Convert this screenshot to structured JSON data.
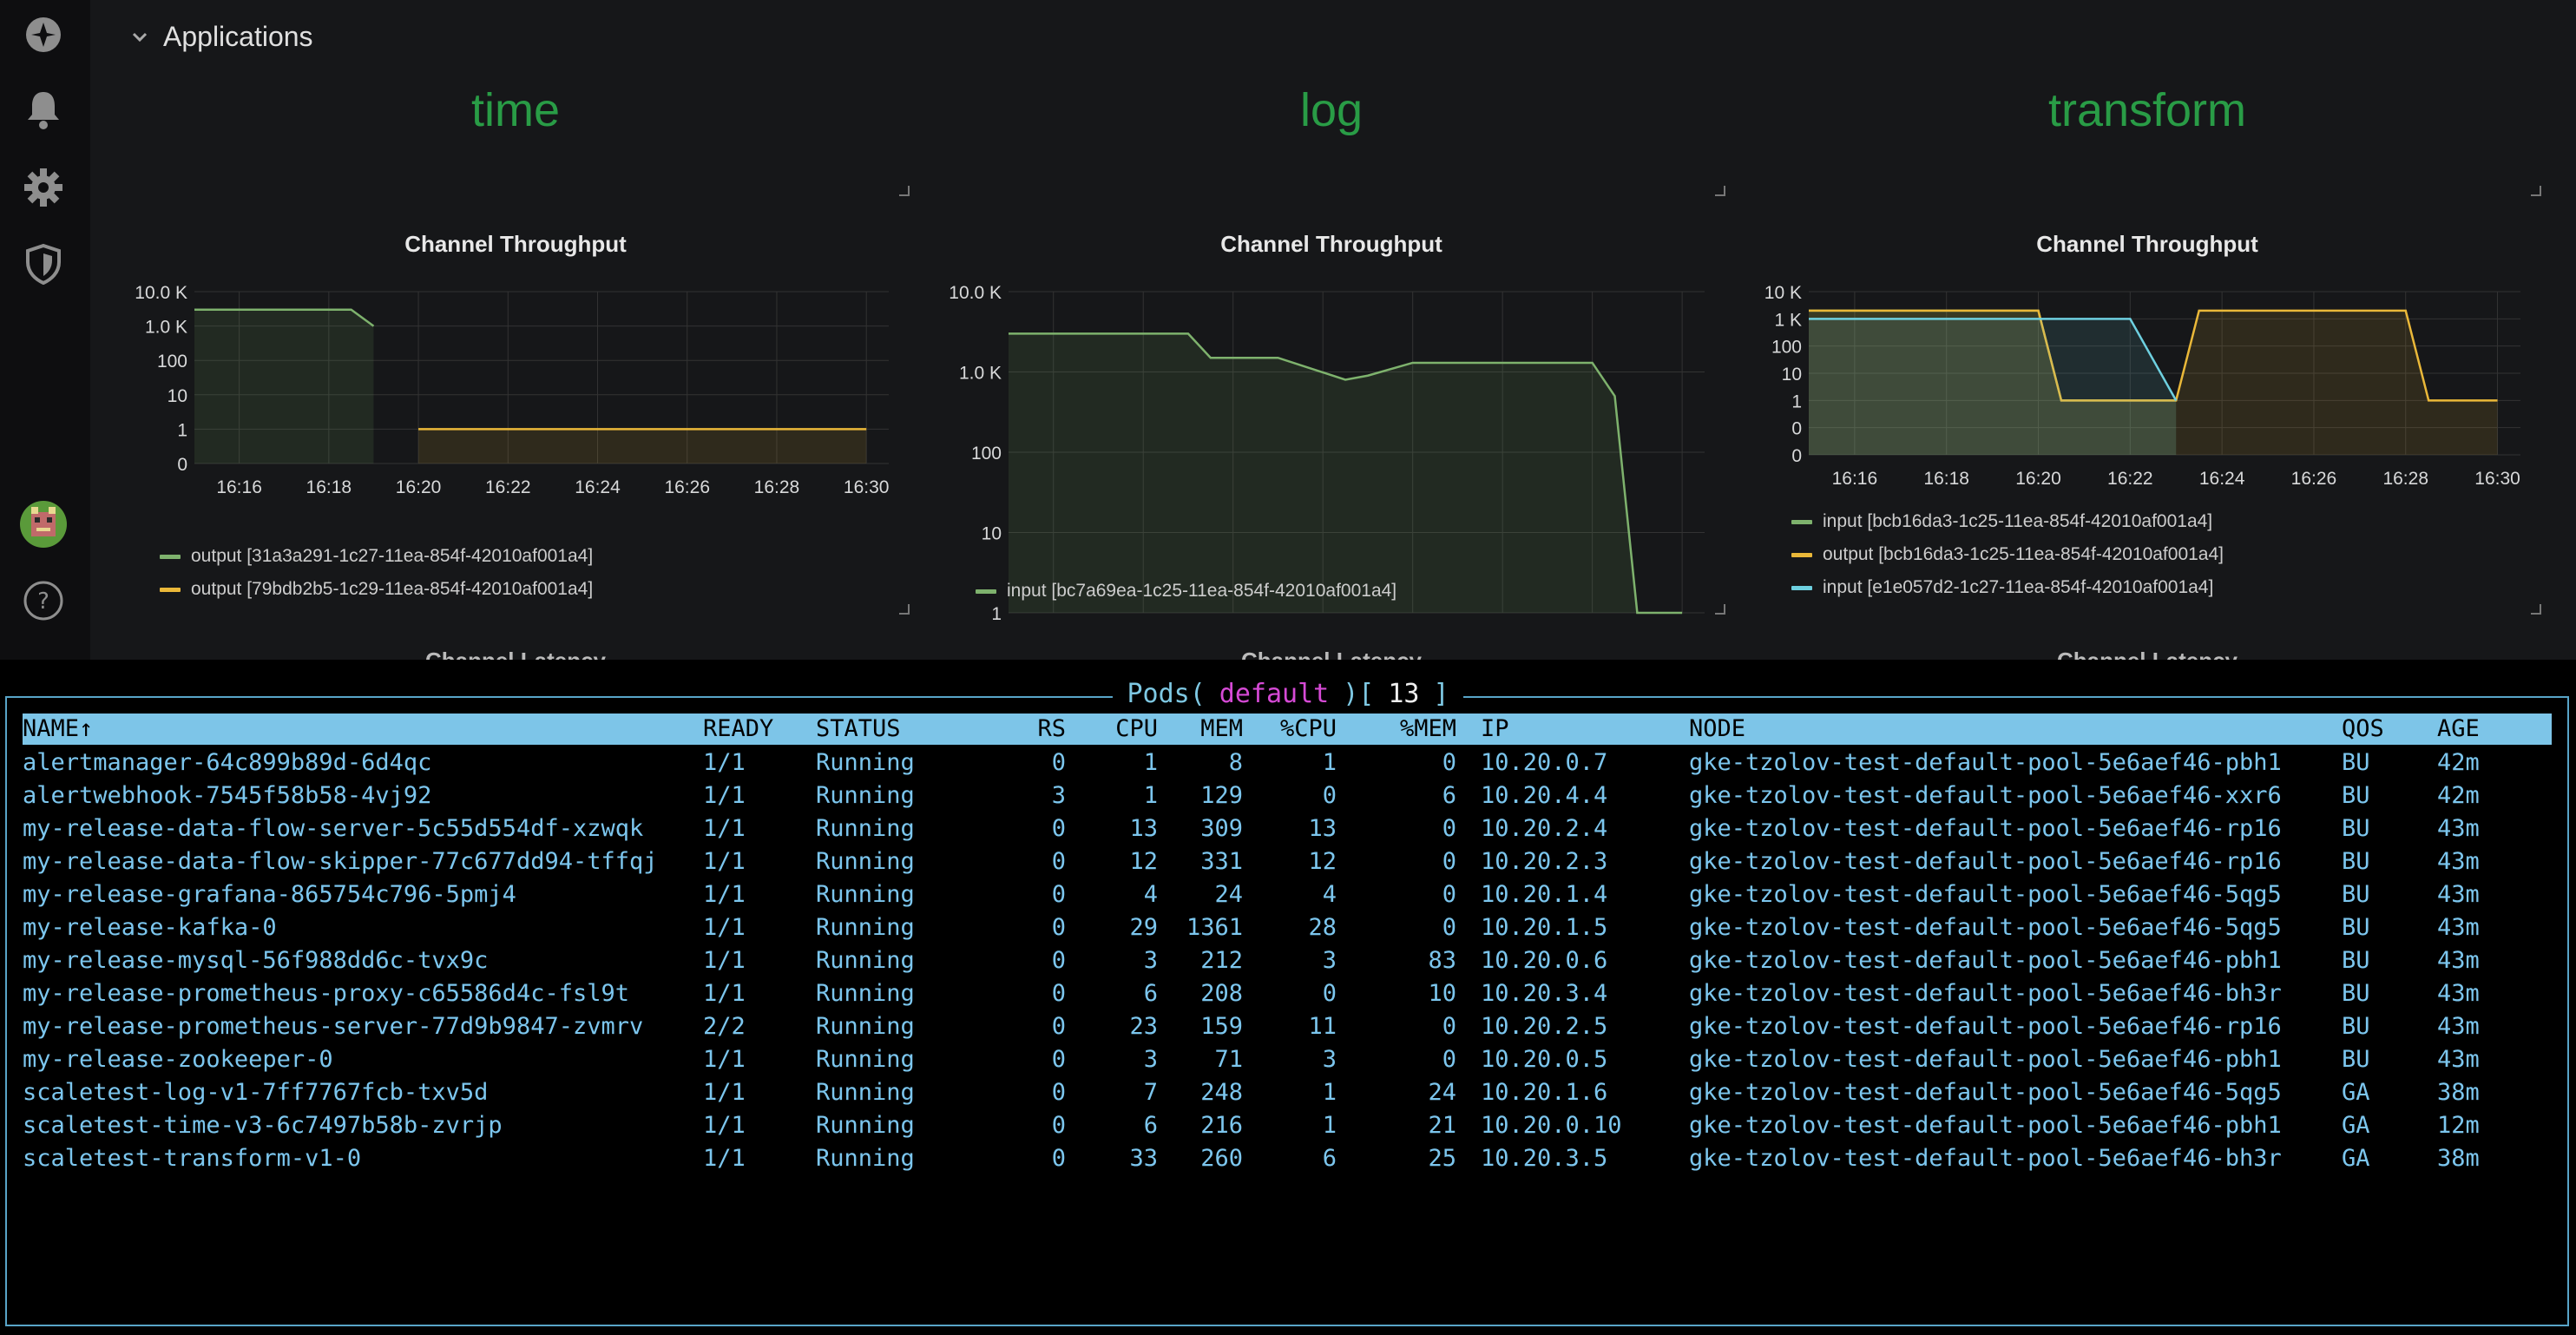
{
  "grafana": {
    "row_title": "Applications",
    "sidebar_icons": [
      "grafana-logo-icon",
      "bell-icon",
      "gear-icon",
      "shield-icon",
      "avatar",
      "help-icon"
    ],
    "panels": [
      {
        "app": "time",
        "chart_title": "Channel Throughput",
        "y_ticks": [
          "10.0 K",
          "1.0 K",
          "100",
          "10",
          "1",
          "0"
        ],
        "x_ticks": [
          "16:16",
          "16:18",
          "16:20",
          "16:22",
          "16:24",
          "16:26",
          "16:28",
          "16:30"
        ],
        "legend": [
          {
            "label": "output [31a3a291-1c27-11ea-854f-42010af001a4]",
            "color": "#7eb26d"
          },
          {
            "label": "output [79bdb2b5-1c29-11ea-854f-42010af001a4]",
            "color": "#eab839"
          }
        ],
        "next_title": "Channel Latency"
      },
      {
        "app": "log",
        "chart_title": "Channel Throughput",
        "y_ticks": [
          "10.0 K",
          "1.0 K",
          "100",
          "10",
          "1"
        ],
        "x_ticks": [
          "16:16",
          "16:18",
          "16:20",
          "16:22",
          "16:24",
          "16:26",
          "16:28",
          "16:30"
        ],
        "legend": [
          {
            "label": "input [bc7a69ea-1c25-11ea-854f-42010af001a4]",
            "color": "#7eb26d"
          }
        ],
        "next_title": "Channel Latency"
      },
      {
        "app": "transform",
        "chart_title": "Channel Throughput",
        "y_ticks": [
          "10 K",
          "1 K",
          "100",
          "10",
          "1",
          "0",
          "0"
        ],
        "x_ticks": [
          "16:16",
          "16:18",
          "16:20",
          "16:22",
          "16:24",
          "16:26",
          "16:28",
          "16:30"
        ],
        "legend": [
          {
            "label": "input [bcb16da3-1c25-11ea-854f-42010af001a4]",
            "color": "#7eb26d"
          },
          {
            "label": "output [bcb16da3-1c25-11ea-854f-42010af001a4]",
            "color": "#eab839"
          },
          {
            "label": "input [e1e057d2-1c27-11ea-854f-42010af001a4]",
            "color": "#6ed0e0"
          }
        ],
        "next_title": "Channel Latency"
      }
    ]
  },
  "chart_data": [
    {
      "type": "area",
      "title": "Channel Throughput",
      "x": [
        "16:15",
        "16:16",
        "16:17",
        "16:18",
        "16:18.5",
        "16:19",
        "16:20",
        "16:22",
        "16:24",
        "16:26",
        "16:28",
        "16:30"
      ],
      "series": [
        {
          "name": "output [31a3a291-1c27-11ea-854f-42010af001a4]",
          "values": [
            3000,
            3000,
            3000,
            3000,
            3000,
            1000,
            null,
            null,
            null,
            null,
            null,
            null
          ]
        },
        {
          "name": "output [79bdb2b5-1c29-11ea-854f-42010af001a4]",
          "values": [
            null,
            null,
            null,
            null,
            null,
            null,
            1,
            1,
            1,
            1,
            1,
            1
          ]
        }
      ],
      "y_scale": "log"
    },
    {
      "type": "area",
      "title": "Channel Throughput",
      "x": [
        "16:15",
        "16:17",
        "16:19",
        "16:19.5",
        "16:21",
        "16:22.5",
        "16:23",
        "16:24",
        "16:26",
        "16:28",
        "16:28.5",
        "16:29",
        "16:30"
      ],
      "series": [
        {
          "name": "input [bc7a69ea-1c25-11ea-854f-42010af001a4]",
          "values": [
            3000,
            3000,
            3000,
            1500,
            1500,
            800,
            900,
            1300,
            1300,
            1300,
            500,
            1,
            1
          ]
        }
      ],
      "y_scale": "log"
    },
    {
      "type": "area",
      "title": "Channel Throughput",
      "x": [
        "16:15",
        "16:20",
        "16:20.5",
        "16:22",
        "16:23",
        "16:23.5",
        "16:24",
        "16:28",
        "16:28.5",
        "16:30"
      ],
      "series": [
        {
          "name": "input [bcb16da3-1c25-11ea-854f-42010af001a4]",
          "values": [
            2000,
            2000,
            1,
            1,
            1,
            null,
            null,
            null,
            null,
            null
          ]
        },
        {
          "name": "output [bcb16da3-1c25-11ea-854f-42010af001a4]",
          "values": [
            2000,
            2000,
            1,
            1,
            1,
            2000,
            2000,
            2000,
            1,
            1
          ]
        },
        {
          "name": "input [e1e057d2-1c27-11ea-854f-42010af001a4]",
          "values": [
            1000,
            1000,
            1000,
            1000,
            1,
            null,
            null,
            null,
            null,
            null
          ]
        }
      ],
      "y_scale": "log"
    }
  ],
  "terminal": {
    "title_prefix": "Pods(",
    "title_namespace": "default",
    "title_mid": ")[",
    "title_count": "13",
    "title_suffix": "]",
    "columns": [
      "NAME↑",
      "READY",
      "STATUS",
      "RS",
      "CPU",
      "MEM",
      "%CPU",
      "%MEM",
      "IP",
      "NODE",
      "QOS",
      "AGE"
    ],
    "rows": [
      [
        "alertmanager-64c899b89d-6d4qc",
        "1/1",
        "Running",
        "0",
        "1",
        "8",
        "1",
        "0",
        "10.20.0.7",
        "gke-tzolov-test-default-pool-5e6aef46-pbh1",
        "BU",
        "42m"
      ],
      [
        "alertwebhook-7545f58b58-4vj92",
        "1/1",
        "Running",
        "3",
        "1",
        "129",
        "0",
        "6",
        "10.20.4.4",
        "gke-tzolov-test-default-pool-5e6aef46-xxr6",
        "BU",
        "42m"
      ],
      [
        "my-release-data-flow-server-5c55d554df-xzwqk",
        "1/1",
        "Running",
        "0",
        "13",
        "309",
        "13",
        "0",
        "10.20.2.4",
        "gke-tzolov-test-default-pool-5e6aef46-rp16",
        "BU",
        "43m"
      ],
      [
        "my-release-data-flow-skipper-77c677dd94-tffqj",
        "1/1",
        "Running",
        "0",
        "12",
        "331",
        "12",
        "0",
        "10.20.2.3",
        "gke-tzolov-test-default-pool-5e6aef46-rp16",
        "BU",
        "43m"
      ],
      [
        "my-release-grafana-865754c796-5pmj4",
        "1/1",
        "Running",
        "0",
        "4",
        "24",
        "4",
        "0",
        "10.20.1.4",
        "gke-tzolov-test-default-pool-5e6aef46-5qg5",
        "BU",
        "43m"
      ],
      [
        "my-release-kafka-0",
        "1/1",
        "Running",
        "0",
        "29",
        "1361",
        "28",
        "0",
        "10.20.1.5",
        "gke-tzolov-test-default-pool-5e6aef46-5qg5",
        "BU",
        "43m"
      ],
      [
        "my-release-mysql-56f988dd6c-tvx9c",
        "1/1",
        "Running",
        "0",
        "3",
        "212",
        "3",
        "83",
        "10.20.0.6",
        "gke-tzolov-test-default-pool-5e6aef46-pbh1",
        "BU",
        "43m"
      ],
      [
        "my-release-prometheus-proxy-c65586d4c-fsl9t",
        "1/1",
        "Running",
        "0",
        "6",
        "208",
        "0",
        "10",
        "10.20.3.4",
        "gke-tzolov-test-default-pool-5e6aef46-bh3r",
        "BU",
        "43m"
      ],
      [
        "my-release-prometheus-server-77d9b9847-zvmrv",
        "2/2",
        "Running",
        "0",
        "23",
        "159",
        "11",
        "0",
        "10.20.2.5",
        "gke-tzolov-test-default-pool-5e6aef46-rp16",
        "BU",
        "43m"
      ],
      [
        "my-release-zookeeper-0",
        "1/1",
        "Running",
        "0",
        "3",
        "71",
        "3",
        "0",
        "10.20.0.5",
        "gke-tzolov-test-default-pool-5e6aef46-pbh1",
        "BU",
        "43m"
      ],
      [
        "scaletest-log-v1-7ff7767fcb-txv5d",
        "1/1",
        "Running",
        "0",
        "7",
        "248",
        "1",
        "24",
        "10.20.1.6",
        "gke-tzolov-test-default-pool-5e6aef46-5qg5",
        "GA",
        "38m"
      ],
      [
        "scaletest-time-v3-6c7497b58b-zvrjp",
        "1/1",
        "Running",
        "0",
        "6",
        "216",
        "1",
        "21",
        "10.20.0.10",
        "gke-tzolov-test-default-pool-5e6aef46-pbh1",
        "GA",
        "12m"
      ],
      [
        "scaletest-transform-v1-0",
        "1/1",
        "Running",
        "0",
        "33",
        "260",
        "6",
        "25",
        "10.20.3.5",
        "gke-tzolov-test-default-pool-5e6aef46-bh3r",
        "GA",
        "38m"
      ]
    ]
  }
}
